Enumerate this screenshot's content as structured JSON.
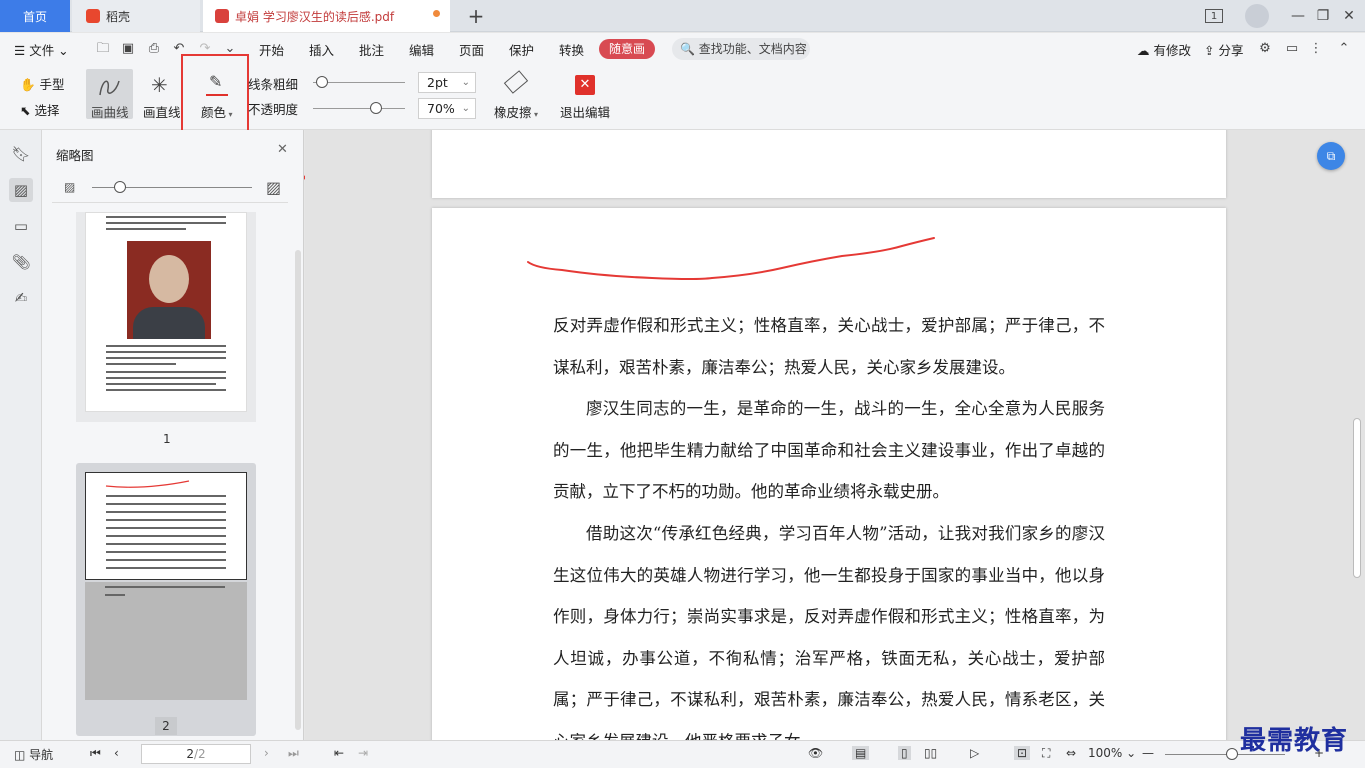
{
  "tabs": {
    "home": "首页",
    "docer": "稻壳",
    "document": "卓娟 学习廖汉生的读后感.pdf"
  },
  "window": {
    "page_count_badge": "1"
  },
  "menu": {
    "file": "文件",
    "items": [
      "开始",
      "插入",
      "批注",
      "编辑",
      "页面",
      "保护",
      "转换"
    ],
    "active": "随意画",
    "search_placeholder": "查找功能、文档内容",
    "modified": "有修改",
    "share": "分享"
  },
  "ribbon": {
    "hand": "手型",
    "select": "选择",
    "draw_curve": "画曲线",
    "draw_line": "画直线",
    "color": "颜色",
    "line_width_label": "线条粗细",
    "line_width_value": "2pt",
    "opacity_label": "不透明度",
    "opacity_value": "70%",
    "eraser": "橡皮擦",
    "exit_edit": "退出编辑",
    "line_width_level": 0.0,
    "opacity_level": 0.7,
    "pen_color": "#e0312b",
    "highlight_color": "#e53935"
  },
  "sidebar": {
    "title": "缩略图",
    "thumbs": [
      {
        "label": "1"
      },
      {
        "label": "2"
      }
    ]
  },
  "document": {
    "paragraphs": [
      "反对弄虚作假和形式主义；性格直率，关心战士，爱护部属；严于律己，不谋私利，艰苦朴素，廉洁奉公；热爱人民，关心家乡发展建设。",
      "廖汉生同志的一生，是革命的一生，战斗的一生，全心全意为人民服务的一生，他把毕生精力献给了中国革命和社会主义建设事业，作出了卓越的贡献，立下了不朽的功勋。他的革命业绩将永载史册。",
      "借助这次“传承红色经典，学习百年人物”活动，让我对我们家乡的廖汉生这位伟大的英雄人物进行学习，他一生都投身于国家的事业当中，他以身作则，身体力行；崇尚实事求是，反对弄虚作假和形式主义；性格直率，为人坦诚，办事公道，不徇私情；治军严格，铁面无私，关心战士，爱护部属；严于律己，不谋私利，艰苦朴素，廉洁奉公，热爱人民，情系老区，关心家乡发展建设，他严格要求子女"
    ]
  },
  "status": {
    "nav": "导航",
    "page_current": "2",
    "page_total": "/2",
    "zoom": "100%"
  },
  "watermark": "最需教育"
}
